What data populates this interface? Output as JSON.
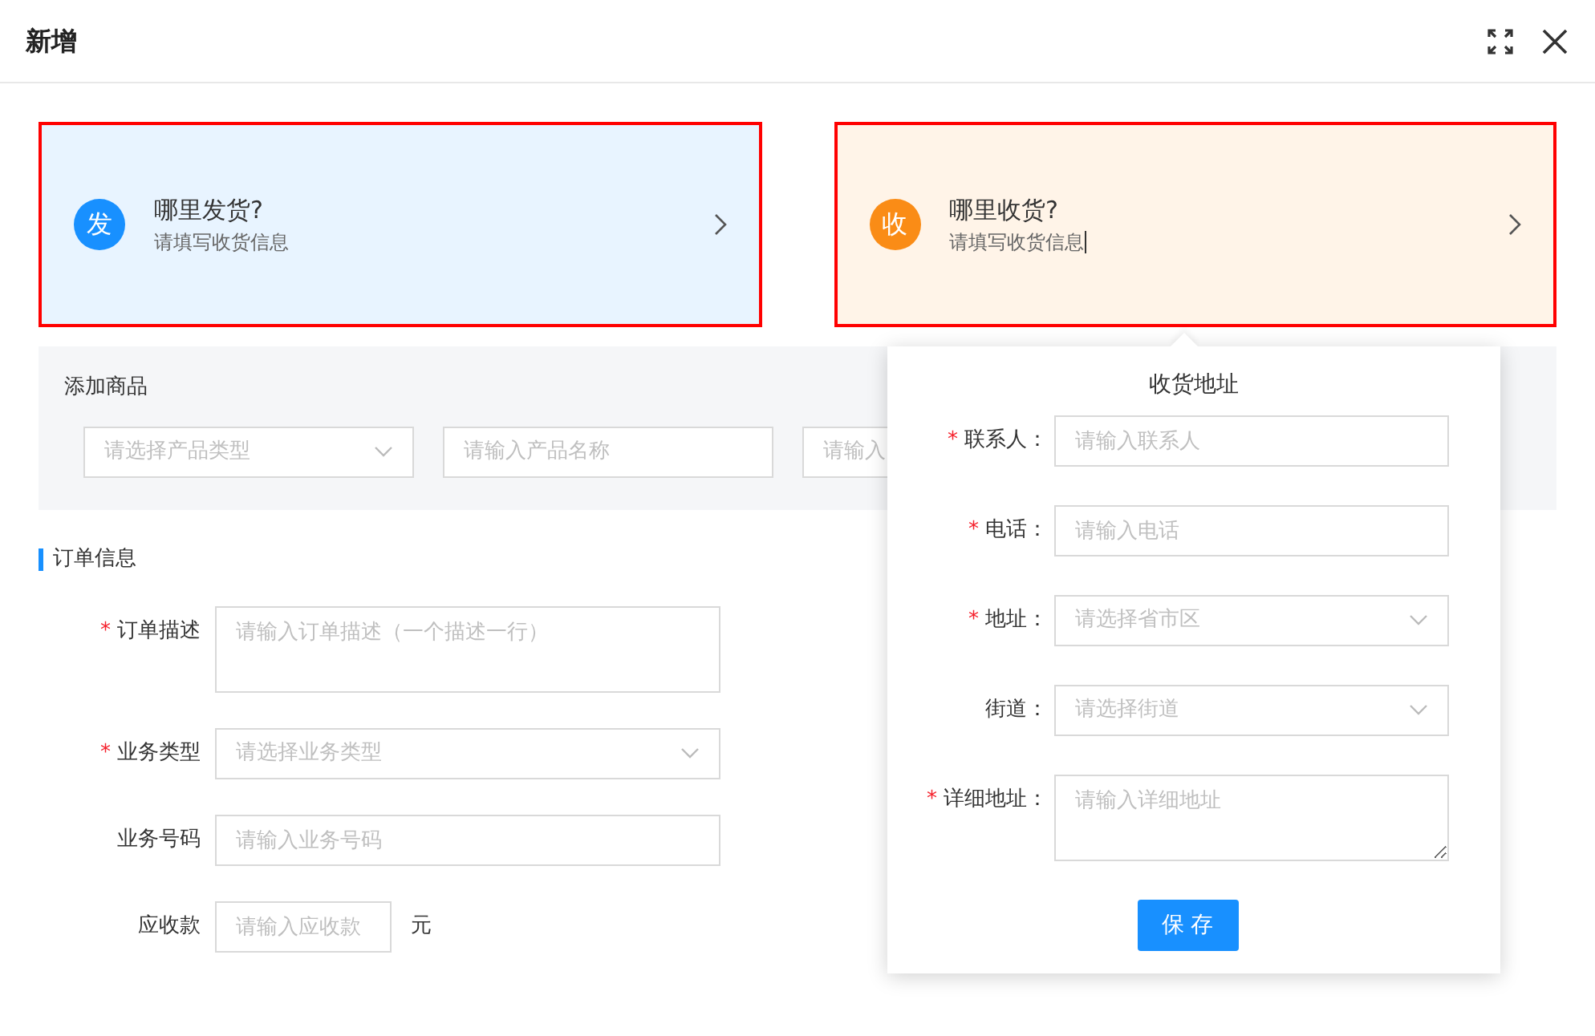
{
  "dialog": {
    "title": "新增"
  },
  "address_cards": [
    {
      "badge": "发",
      "title": "哪里发货?",
      "subtitle": "请填写收货信息",
      "color": "#1890ff",
      "highlighted": true,
      "focused": false
    },
    {
      "badge": "收",
      "title": "哪里收货?",
      "subtitle": "请填写收货信息",
      "color": "#fa8c16",
      "highlighted": true,
      "focused": true
    }
  ],
  "add_goods": {
    "title": "添加商品",
    "fields": [
      {
        "kind": "select",
        "placeholder": "请选择产品类型"
      },
      {
        "kind": "input",
        "placeholder": "请输入产品名称"
      },
      {
        "kind": "input",
        "placeholder": "请输入"
      }
    ]
  },
  "order_info": {
    "title": "订单信息",
    "fields": [
      {
        "kind": "textarea",
        "required_mark": "*",
        "label": "订单描述",
        "placeholder": "请输入订单描述（一个描述一行）"
      },
      {
        "kind": "select",
        "required_mark": "*",
        "label": "业务类型",
        "placeholder": "请选择业务类型"
      },
      {
        "kind": "input",
        "label": "业务号码",
        "placeholder": "请输入业务号码"
      },
      {
        "kind": "short",
        "label": "应收款",
        "placeholder": "请输入应收款",
        "unit": "元"
      }
    ]
  },
  "address_popover": {
    "title": "收货地址",
    "fields": [
      {
        "kind": "input",
        "required_mark": "*",
        "label": "联系人：",
        "placeholder": "请输入联系人"
      },
      {
        "kind": "input",
        "required_mark": "*",
        "label": "电话：",
        "placeholder": "请输入电话"
      },
      {
        "kind": "select",
        "required_mark": "*",
        "label": "地址：",
        "placeholder": "请选择省市区"
      },
      {
        "kind": "select",
        "label": "街道：",
        "placeholder": "请选择街道"
      },
      {
        "kind": "textarea",
        "required_mark": "*",
        "label": "详细地址：",
        "placeholder": "请输入详细地址"
      }
    ],
    "button": "保 存"
  }
}
